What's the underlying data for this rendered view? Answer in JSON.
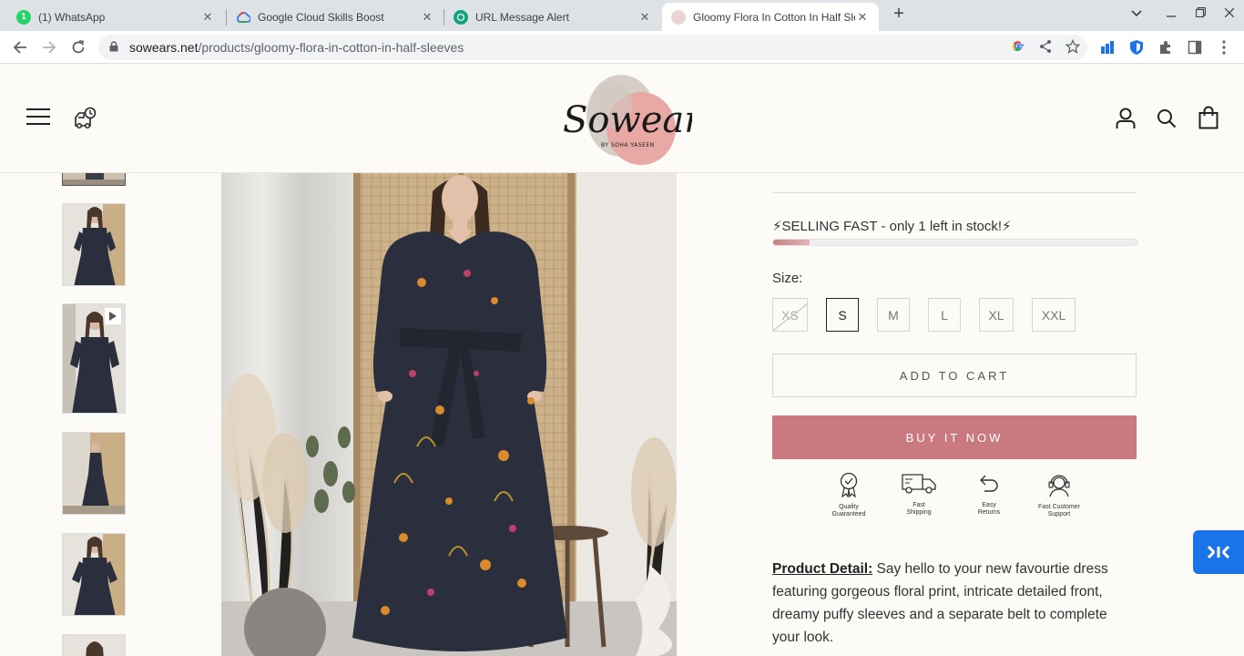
{
  "browser": {
    "tabs": [
      {
        "title": "(1) WhatsApp",
        "close": "✕"
      },
      {
        "title": "Google Cloud Skills Boost",
        "close": "✕"
      },
      {
        "title": "URL Message Alert",
        "close": "✕"
      },
      {
        "title": "Gloomy Flora In Cotton In Half Sleeves",
        "close": "✕"
      }
    ],
    "new_tab": "+",
    "url_host": "sowears.net",
    "url_path": "/products/gloomy-flora-in-cotton-in-half-sleeves"
  },
  "product": {
    "stock_text": "⚡SELLING FAST - only 1 left in stock!⚡",
    "stock_level": 0.1,
    "size_label": "Size:",
    "sizes": [
      {
        "label": "XS",
        "state": "sold-out"
      },
      {
        "label": "S",
        "state": "selected"
      },
      {
        "label": "M",
        "state": "available"
      },
      {
        "label": "L",
        "state": "available"
      },
      {
        "label": "XL",
        "state": "available"
      },
      {
        "label": "XXL",
        "state": "available"
      }
    ],
    "add_to_cart": "ADD TO CART",
    "buy_now": "BUY IT NOW",
    "badges": [
      {
        "line1": "Quality",
        "line2": "Guaranteed",
        "icon": "ribbon-icon"
      },
      {
        "line1": "Fast",
        "line2": "Shipping",
        "icon": "truck-icon"
      },
      {
        "line1": "Easy",
        "line2": "Returns",
        "icon": "return-arrow-icon"
      },
      {
        "line1": "Fast Customer",
        "line2": "Support",
        "icon": "headset-icon"
      }
    ],
    "detail_label": "Product Detail:",
    "detail_text": " Say hello to your new favourtie dress featuring gorgeous floral print, intricate detailed front, dreamy puffy sleeves and a separate belt to complete your look."
  },
  "colors": {
    "accent": "#c9797f",
    "background": "#fdfbf7",
    "dress": "#2b2f3d"
  }
}
